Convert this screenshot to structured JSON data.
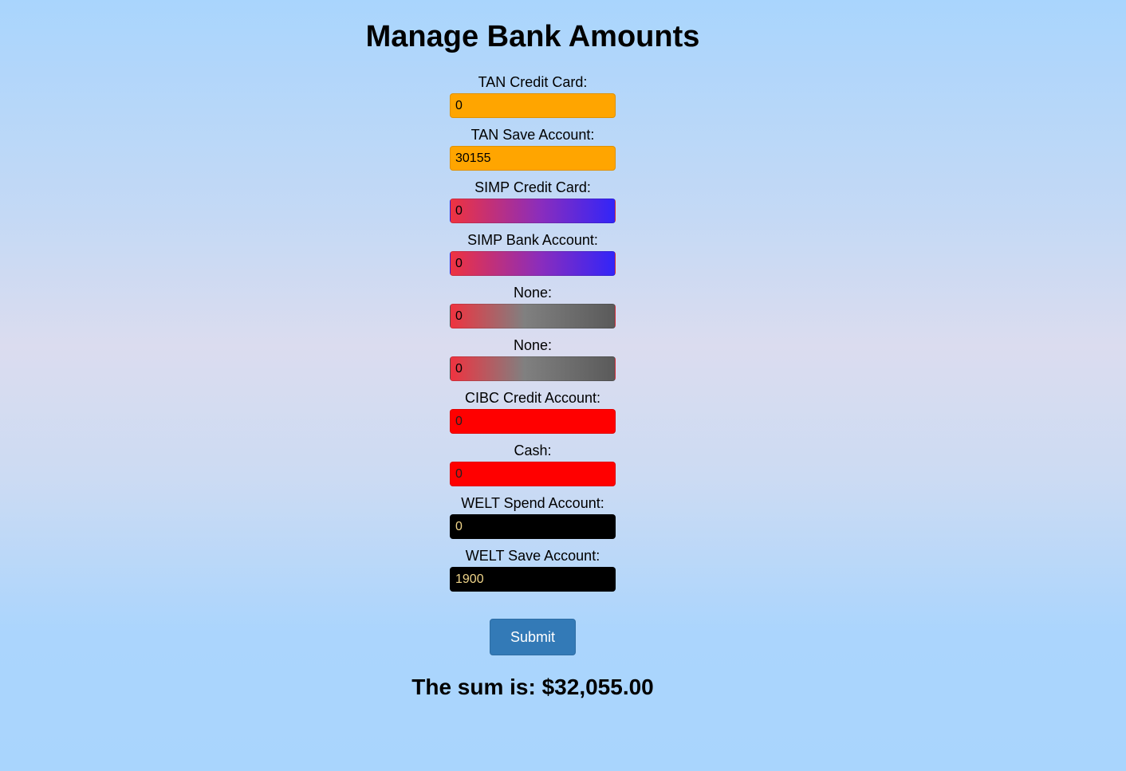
{
  "page": {
    "title": "Manage Bank Amounts"
  },
  "colors": {
    "background_top": "#a9d5fd",
    "background_middle": "#dbdcef",
    "tan": "#ffa500",
    "simp_start": "#ef3340",
    "simp_end": "#3225f8",
    "none_start": "#ef3340",
    "none_end": "#5a5a5a",
    "cibc": "#ff0000",
    "welt": "#000000",
    "submit": "#337ab7"
  },
  "form": {
    "fields": [
      {
        "label": "TAN Credit Card:",
        "value": "0"
      },
      {
        "label": "TAN Save Account:",
        "value": "30155"
      },
      {
        "label": "SIMP Credit Card:",
        "value": "0"
      },
      {
        "label": "SIMP Bank Account:",
        "value": "0"
      },
      {
        "label": "None:",
        "value": "0"
      },
      {
        "label": "None:",
        "value": "0"
      },
      {
        "label": "CIBC Credit Account:",
        "value": "0"
      },
      {
        "label": "Cash:",
        "value": "0"
      },
      {
        "label": "WELT Spend Account:",
        "value": "0"
      },
      {
        "label": "WELT Save Account:",
        "value": "1900"
      }
    ],
    "submit_label": "Submit"
  },
  "result": {
    "sum_text": "The sum is: $32,055.00"
  }
}
